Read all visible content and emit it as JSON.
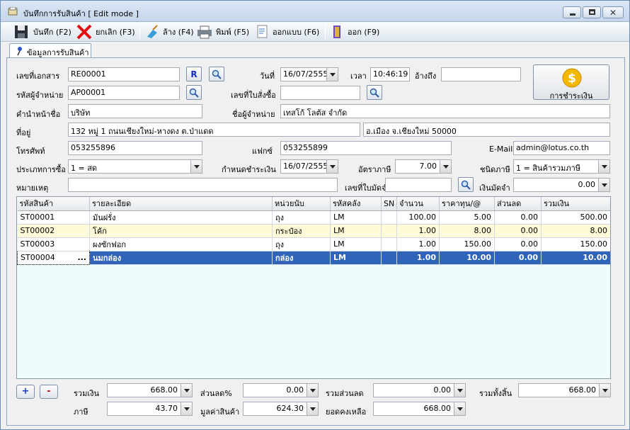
{
  "window": {
    "title": "บันทึกการรับสินค้า [ Edit mode ]"
  },
  "toolbar": {
    "save": "บันทึก (F2)",
    "cancel": "ยกเลิก (F3)",
    "clear": "ล้าง (F4)",
    "print": "พิมพ์ (F5)",
    "design": "ออกแบบ (F6)",
    "exit": "ออก (F9)"
  },
  "tab": {
    "label": "ข้อมูลการรับสินค้า"
  },
  "form": {
    "doc_no_label": "เลขที่เอกสาร",
    "doc_no": "RE00001",
    "r_button": "R",
    "date_label": "วันที่",
    "date": "16/07/2555",
    "time_label": "เวลา",
    "time": "10:46:19",
    "ref_label": "อ้างถึง",
    "ref": "",
    "supplier_code_label": "รหัสผู้จำหน่าย",
    "supplier_code": "AP00001",
    "po_no_label": "เลขที่ใบสั่งซื้อ",
    "po_no": "",
    "prefix_label": "คำนำหน้าชื่อ",
    "prefix": "บริษัท",
    "supplier_name_label": "ชื่อผู้จำหน่าย",
    "supplier_name": "เทสโก้ โลตัส จำกัด",
    "address_label": "ที่อยู่",
    "address1": "132 หมู่ 1 ถนนเชียงใหม่-หางดง ต.ป่าแดด",
    "address2": "อ.เมือง จ.เชียงใหม่ 50000",
    "phone_label": "โทรศัพท์",
    "phone": "053255896",
    "fax_label": "แฟกซ์",
    "fax": "053255899",
    "email_label": "E-Mail",
    "email": "admin@lotus.co.th",
    "purchase_type_label": "ประเภทการซื้อ",
    "purchase_type": "1 = สด",
    "due_date_label": "กำหนดชำระเงิน",
    "due_date": "16/07/2555",
    "tax_rate_label": "อัตราภาษี",
    "tax_rate": "7.00",
    "tax_type_label": "ชนิดภาษี",
    "tax_type": "1 = สินค้ารวมภาษี",
    "note_label": "หมายเหตุ",
    "note": "",
    "deposit_no_label": "เลขที่ใบมัดจำ",
    "deposit_no": "",
    "deposit_amount_label": "เงินมัดจำ",
    "deposit_amount": "0.00",
    "pay_button": "การชำระเงิน"
  },
  "grid": {
    "columns": [
      "รหัสสินค้า",
      "รายละเอียด",
      "หน่วยนับ",
      "รหัสคลัง",
      "SN",
      "จำนวน",
      "ราคาทุน/@",
      "ส่วนลด",
      "รวมเงิน"
    ],
    "rows": [
      [
        "ST00001",
        "มันฝรั่ง",
        "ถุง",
        "LM",
        "",
        "100.00",
        "5.00",
        "0.00",
        "500.00"
      ],
      [
        "ST00002",
        "โค้ก",
        "กระป๋อง",
        "LM",
        "",
        "1.00",
        "8.00",
        "0.00",
        "8.00"
      ],
      [
        "ST00003",
        "ผงซักฟอก",
        "ถุง",
        "LM",
        "",
        "1.00",
        "150.00",
        "0.00",
        "150.00"
      ],
      [
        "ST00004",
        "นมกล่อง",
        "กล่อง",
        "LM",
        "",
        "1.00",
        "10.00",
        "0.00",
        "10.00"
      ]
    ],
    "selected_row": 3,
    "ellipsis": "..."
  },
  "footer": {
    "add_button": "+",
    "remove_button": "-",
    "subtotal_label": "รวมเงิน",
    "subtotal": "668.00",
    "discount_pct_label": "ส่วนลด%",
    "discount_pct": "0.00",
    "total_discount_label": "รวมส่วนลด",
    "total_discount": "0.00",
    "grand_total_label": "รวมทั้งสิ้น",
    "grand_total": "668.00",
    "tax_label": "ภาษี",
    "tax": "43.70",
    "goods_value_label": "มูลค่าสินค้า",
    "goods_value": "624.30",
    "balance_label": "ยอดคงเหลือ",
    "balance": "668.00"
  }
}
